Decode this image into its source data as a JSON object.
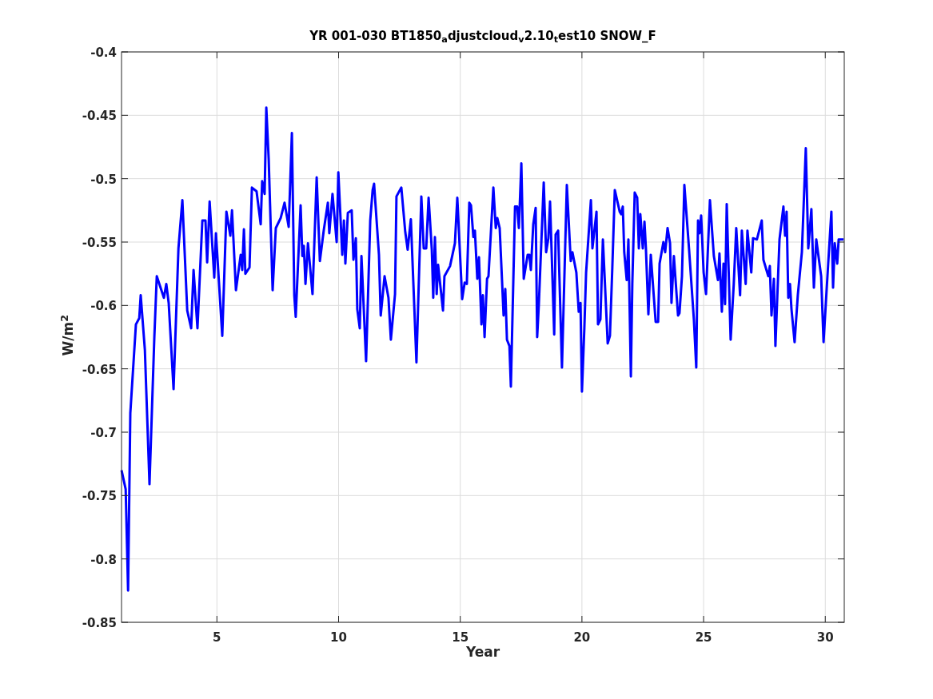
{
  "chart_data": {
    "type": "line",
    "title": "YR 001-030 BT1850$_{a}$djustcloud$_{v}$2.10$_{t}$est10 SNOW_F",
    "grid": true,
    "xlabel": "Year",
    "ylabel": "W/m$^{2}$",
    "xlim": [
      1.08,
      30.78
    ],
    "ylim": [
      -0.85,
      -0.4
    ],
    "xticks": [
      5,
      10,
      15,
      20,
      25,
      30
    ],
    "yticks": [
      -0.85,
      -0.8,
      -0.75,
      -0.7,
      -0.65,
      -0.6,
      -0.55,
      -0.5,
      -0.45,
      -0.4
    ],
    "x": [
      1.08,
      1.25,
      1.35,
      1.44,
      1.67,
      1.81,
      1.87,
      2.04,
      2.23,
      2.43,
      2.53,
      2.82,
      2.92,
      3.02,
      3.22,
      3.42,
      3.58,
      3.78,
      3.94,
      4.04,
      4.2,
      4.4,
      4.53,
      4.6,
      4.7,
      4.89,
      4.96,
      5.22,
      5.39,
      5.55,
      5.62,
      5.78,
      5.98,
      6.04,
      6.11,
      6.17,
      6.34,
      6.44,
      6.63,
      6.8,
      6.86,
      6.96,
      7.03,
      7.13,
      7.29,
      7.42,
      7.62,
      7.78,
      7.95,
      8.08,
      8.18,
      8.24,
      8.44,
      8.51,
      8.57,
      8.64,
      8.74,
      8.93,
      9.1,
      9.23,
      9.39,
      9.56,
      9.62,
      9.75,
      9.92,
      9.99,
      10.15,
      10.22,
      10.28,
      10.38,
      10.54,
      10.61,
      10.71,
      10.77,
      10.87,
      10.94,
      11.13,
      11.3,
      11.4,
      11.46,
      11.66,
      11.73,
      11.89,
      12.05,
      12.15,
      12.32,
      12.38,
      12.58,
      12.74,
      12.84,
      12.97,
      13.2,
      13.4,
      13.5,
      13.6,
      13.7,
      13.83,
      13.89,
      13.96,
      14.03,
      14.09,
      14.29,
      14.35,
      14.58,
      14.78,
      14.88,
      15.08,
      15.18,
      15.27,
      15.37,
      15.44,
      15.54,
      15.6,
      15.7,
      15.77,
      15.87,
      15.93,
      16.0,
      16.1,
      16.16,
      16.36,
      16.46,
      16.52,
      16.62,
      16.78,
      16.85,
      16.92,
      17.02,
      17.08,
      17.25,
      17.34,
      17.41,
      17.51,
      17.61,
      17.77,
      17.84,
      17.9,
      18.0,
      18.1,
      18.16,
      18.23,
      18.43,
      18.53,
      18.62,
      18.69,
      18.79,
      18.86,
      18.92,
      19.02,
      19.18,
      19.38,
      19.54,
      19.61,
      19.77,
      19.87,
      19.94,
      20.0,
      20.1,
      20.17,
      20.37,
      20.43,
      20.6,
      20.66,
      20.76,
      20.86,
      21.06,
      21.15,
      21.25,
      21.35,
      21.55,
      21.61,
      21.68,
      21.74,
      21.84,
      21.91,
      22.01,
      22.07,
      22.17,
      22.27,
      22.34,
      22.4,
      22.5,
      22.57,
      22.63,
      22.73,
      22.83,
      23.03,
      23.13,
      23.19,
      23.35,
      23.42,
      23.52,
      23.62,
      23.68,
      23.78,
      23.95,
      24.01,
      24.11,
      24.21,
      24.4,
      24.6,
      24.7,
      24.77,
      24.83,
      24.9,
      25.0,
      25.1,
      25.26,
      25.42,
      25.59,
      25.65,
      25.75,
      25.82,
      25.88,
      25.95,
      26.11,
      26.24,
      26.34,
      26.5,
      26.57,
      26.73,
      26.8,
      26.96,
      27.03,
      27.19,
      27.39,
      27.46,
      27.66,
      27.72,
      27.79,
      27.89,
      27.95,
      28.12,
      28.28,
      28.35,
      28.41,
      28.48,
      28.55,
      28.61,
      28.74,
      28.87,
      29.04,
      29.1,
      29.2,
      29.3,
      29.43,
      29.53,
      29.63,
      29.83,
      29.93,
      30.12,
      30.25,
      30.32,
      30.39,
      30.49,
      30.55,
      30.75
    ],
    "series": [
      {
        "color": "#0000ff",
        "values": [
          -0.73,
          -0.745,
          -0.825,
          -0.685,
          -0.615,
          -0.61,
          -0.592,
          -0.635,
          -0.741,
          -0.624,
          -0.577,
          -0.594,
          -0.583,
          -0.598,
          -0.666,
          -0.555,
          -0.517,
          -0.604,
          -0.618,
          -0.572,
          -0.618,
          -0.533,
          -0.533,
          -0.566,
          -0.518,
          -0.578,
          -0.543,
          -0.624,
          -0.526,
          -0.545,
          -0.525,
          -0.588,
          -0.56,
          -0.572,
          -0.54,
          -0.575,
          -0.57,
          -0.507,
          -0.51,
          -0.536,
          -0.502,
          -0.512,
          -0.444,
          -0.485,
          -0.588,
          -0.539,
          -0.531,
          -0.519,
          -0.538,
          -0.464,
          -0.592,
          -0.609,
          -0.521,
          -0.561,
          -0.553,
          -0.583,
          -0.551,
          -0.591,
          -0.499,
          -0.565,
          -0.541,
          -0.519,
          -0.543,
          -0.512,
          -0.55,
          -0.495,
          -0.56,
          -0.533,
          -0.567,
          -0.527,
          -0.525,
          -0.564,
          -0.547,
          -0.603,
          -0.618,
          -0.561,
          -0.644,
          -0.533,
          -0.509,
          -0.504,
          -0.56,
          -0.608,
          -0.577,
          -0.594,
          -0.627,
          -0.591,
          -0.514,
          -0.507,
          -0.542,
          -0.556,
          -0.532,
          -0.645,
          -0.514,
          -0.555,
          -0.555,
          -0.515,
          -0.556,
          -0.594,
          -0.546,
          -0.591,
          -0.568,
          -0.604,
          -0.577,
          -0.569,
          -0.551,
          -0.515,
          -0.595,
          -0.582,
          -0.583,
          -0.519,
          -0.521,
          -0.546,
          -0.541,
          -0.579,
          -0.562,
          -0.615,
          -0.592,
          -0.625,
          -0.579,
          -0.577,
          -0.507,
          -0.539,
          -0.531,
          -0.539,
          -0.608,
          -0.587,
          -0.627,
          -0.632,
          -0.664,
          -0.522,
          -0.522,
          -0.539,
          -0.488,
          -0.579,
          -0.56,
          -0.56,
          -0.572,
          -0.536,
          -0.523,
          -0.625,
          -0.599,
          -0.503,
          -0.558,
          -0.547,
          -0.518,
          -0.58,
          -0.623,
          -0.544,
          -0.541,
          -0.649,
          -0.505,
          -0.565,
          -0.558,
          -0.574,
          -0.605,
          -0.598,
          -0.668,
          -0.618,
          -0.574,
          -0.517,
          -0.555,
          -0.526,
          -0.615,
          -0.611,
          -0.548,
          -0.63,
          -0.624,
          -0.57,
          -0.509,
          -0.526,
          -0.528,
          -0.522,
          -0.558,
          -0.58,
          -0.548,
          -0.656,
          -0.583,
          -0.511,
          -0.515,
          -0.555,
          -0.528,
          -0.555,
          -0.534,
          -0.555,
          -0.607,
          -0.56,
          -0.613,
          -0.613,
          -0.567,
          -0.55,
          -0.558,
          -0.539,
          -0.551,
          -0.598,
          -0.561,
          -0.608,
          -0.606,
          -0.577,
          -0.505,
          -0.555,
          -0.611,
          -0.649,
          -0.533,
          -0.543,
          -0.529,
          -0.574,
          -0.591,
          -0.517,
          -0.561,
          -0.58,
          -0.559,
          -0.605,
          -0.567,
          -0.599,
          -0.52,
          -0.627,
          -0.583,
          -0.539,
          -0.592,
          -0.541,
          -0.583,
          -0.541,
          -0.574,
          -0.547,
          -0.548,
          -0.533,
          -0.564,
          -0.577,
          -0.569,
          -0.608,
          -0.579,
          -0.632,
          -0.548,
          -0.522,
          -0.545,
          -0.526,
          -0.594,
          -0.583,
          -0.603,
          -0.629,
          -0.592,
          -0.558,
          -0.526,
          -0.476,
          -0.555,
          -0.524,
          -0.586,
          -0.548,
          -0.577,
          -0.629,
          -0.567,
          -0.526,
          -0.586,
          -0.551,
          -0.567,
          -0.548,
          -0.548
        ]
      }
    ]
  }
}
